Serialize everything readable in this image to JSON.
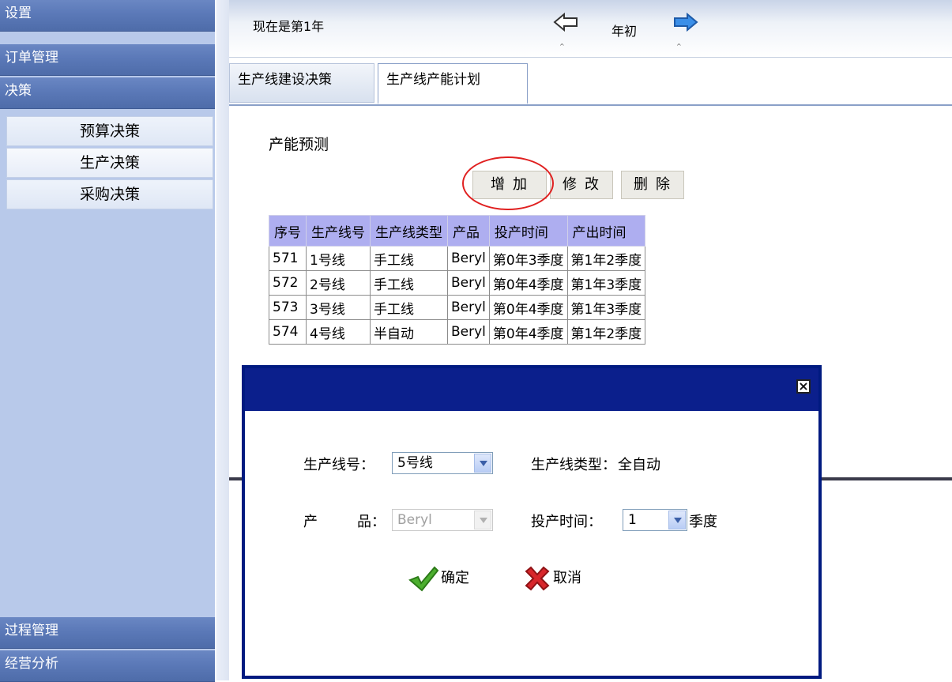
{
  "sidebar": {
    "sections": {
      "settings": "设置",
      "orders": "订单管理",
      "decision": "决策",
      "process": "过程管理",
      "analysis": "经营分析"
    },
    "items": [
      {
        "label": "预算决策"
      },
      {
        "label": "生产决策"
      },
      {
        "label": "采购决策"
      }
    ]
  },
  "topbar": {
    "year_text": "现在是第1年",
    "phase": "年初",
    "prev_icon": "back-arrow-icon",
    "next_icon": "forward-arrow-icon"
  },
  "tabs": [
    {
      "label": "生产线建设决策"
    },
    {
      "label": "生产线产能计划"
    }
  ],
  "content": {
    "section_title": "产能预测",
    "buttons": {
      "add": "增加",
      "edit": "修改",
      "delete": "删除"
    }
  },
  "table": {
    "headers": [
      "序号",
      "生产线号",
      "生产线类型",
      "产品",
      "投产时间",
      "产出时间"
    ],
    "rows": [
      [
        "571",
        "1号线",
        "手工线",
        "Beryl",
        "第0年3季度",
        "第1年2季度"
      ],
      [
        "572",
        "2号线",
        "手工线",
        "Beryl",
        "第0年4季度",
        "第1年3季度"
      ],
      [
        "573",
        "3号线",
        "手工线",
        "Beryl",
        "第0年4季度",
        "第1年3季度"
      ],
      [
        "574",
        "4号线",
        "半自动",
        "Beryl",
        "第0年4季度",
        "第1年2季度"
      ]
    ]
  },
  "dialog": {
    "line_no_label": "生产线号：",
    "line_no_value": "5号线",
    "line_type_label": "生产线类型：",
    "line_type_value": "全自动",
    "product_label_a": "产",
    "product_label_b": "品：",
    "product_value": "Beryl",
    "start_label": "投产时间：",
    "start_value": "1",
    "start_unit": "季度",
    "ok": "确定",
    "cancel": "取消"
  },
  "colors": {
    "sidebar": "#b8c9ea",
    "sidebar_head": "#5b79b8",
    "table_header": "#aeaef0",
    "dialog_title": "#0b1f8c",
    "highlight_circle": "#e02020"
  }
}
